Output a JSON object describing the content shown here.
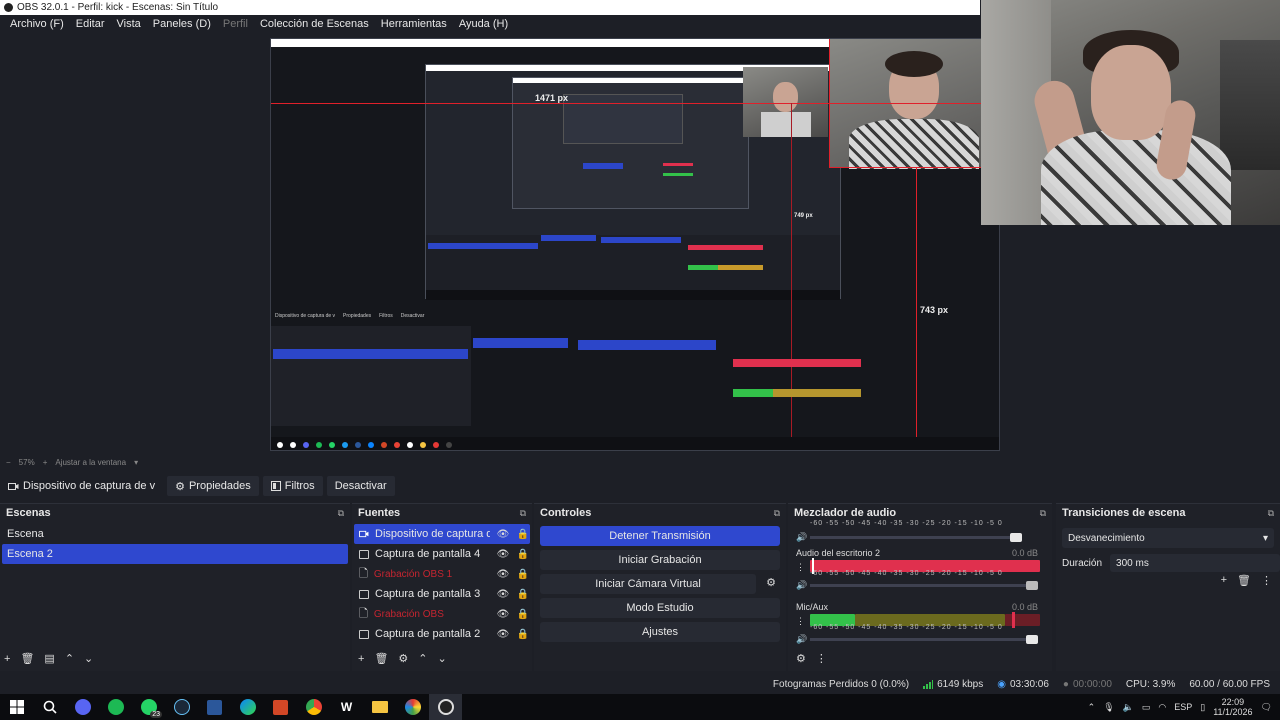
{
  "window": {
    "title": "OBS 32.0.1 - Perfil: kick - Escenas: Sin Título"
  },
  "menu": [
    {
      "label": "Archivo (F)",
      "dim": false
    },
    {
      "label": "Editar",
      "dim": false
    },
    {
      "label": "Vista",
      "dim": false
    },
    {
      "label": "Paneles (D)",
      "dim": false
    },
    {
      "label": "Perfil",
      "dim": true
    },
    {
      "label": "Colección de Escenas",
      "dim": false
    },
    {
      "label": "Herramientas",
      "dim": false
    },
    {
      "label": "Ayuda (H)",
      "dim": false
    }
  ],
  "preview": {
    "measure_width": "1471 px",
    "measure_mid": "749 px",
    "measure_height": "743 px"
  },
  "zoom": {
    "level": "57%",
    "fit_label": "Ajustar a la ventana"
  },
  "source_toolbar": {
    "selected_source": "Dispositivo de captura de v",
    "properties": "Propiedades",
    "filters": "Filtros",
    "deactivate": "Desactivar"
  },
  "scenes": {
    "title": "Escenas",
    "items": [
      {
        "label": "Escena",
        "active": false
      },
      {
        "label": "Escena 2",
        "active": true
      }
    ]
  },
  "sources": {
    "title": "Fuentes",
    "items": [
      {
        "label": "Dispositivo de captura de vide",
        "active": true,
        "type": "camera",
        "muted": false
      },
      {
        "label": "Captura de pantalla 4",
        "active": false,
        "type": "monitor",
        "muted": false
      },
      {
        "label": "Grabación OBS 1",
        "active": false,
        "type": "file",
        "muted": true
      },
      {
        "label": "Captura de pantalla 3",
        "active": false,
        "type": "monitor",
        "muted": false
      },
      {
        "label": "Grabación OBS",
        "active": false,
        "type": "file",
        "muted": true
      },
      {
        "label": "Captura de pantalla 2",
        "active": false,
        "type": "monitor",
        "muted": false
      }
    ]
  },
  "controls": {
    "title": "Controles",
    "stop_stream": "Detener Transmisión",
    "start_recording": "Iniciar Grabación",
    "start_virtual_cam": "Iniciar Cámara Virtual",
    "studio_mode": "Modo Estudio",
    "settings": "Ajustes"
  },
  "mixer": {
    "title": "Mezclador de audio",
    "scale": "-60 -55 -50 -45 -40 -35 -30 -25 -20 -15 -10 -5 0",
    "channels": [
      {
        "name": "Audio del escritorio 2",
        "db": "0.0 dB"
      },
      {
        "name": "Mic/Aux",
        "db": "0.0 dB"
      }
    ]
  },
  "transitions": {
    "title": "Transiciones de escena",
    "selected": "Desvanecimiento",
    "duration_label": "Duración",
    "duration_value": "300 ms"
  },
  "status": {
    "dropped_frames": "Fotogramas Perdidos 0 (0.0%)",
    "bitrate": "6149 kbps",
    "stream_time": "03:30:06",
    "rec_time": "00:00:00",
    "cpu": "CPU: 3.9%",
    "fps": "60.00 / 60.00 FPS"
  },
  "taskbar": {
    "lang": "ESP",
    "time": "22:09",
    "date": "11/1/2026",
    "notifications": "23"
  },
  "colors": {
    "accent": "#2f48cf",
    "meter_red": "#e0304e",
    "meter_green": "#33c14a",
    "guide_red": "#e0202a"
  }
}
